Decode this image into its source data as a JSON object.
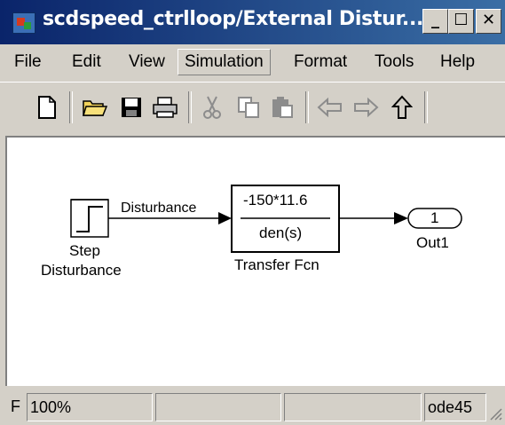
{
  "window": {
    "title": "scdspeed_ctrlloop/External Distur...",
    "minimize_glyph": "_",
    "maximize_glyph": "☐",
    "close_glyph": "✕"
  },
  "menu": {
    "items": [
      "File",
      "Edit",
      "View",
      "Simulation",
      "Format",
      "Tools",
      "Help"
    ],
    "active": "Simulation"
  },
  "toolbar": {
    "icons": [
      "new-file-icon",
      "open-folder-icon",
      "save-icon",
      "print-icon",
      "cut-icon",
      "copy-icon",
      "paste-icon",
      "back-arrow-icon",
      "forward-arrow-icon",
      "up-arrow-icon"
    ]
  },
  "diagram": {
    "step_block_label_line1": "Step",
    "step_block_label_line2": "Disturbance",
    "signal_label": "Disturbance",
    "transfer_numerator": "-150*11.6",
    "transfer_denominator": "den(s)",
    "transfer_label": "Transfer Fcn",
    "outport_number": "1",
    "outport_label": "Out1"
  },
  "status": {
    "left_char": "F",
    "zoom": "100%",
    "solver": "ode45"
  }
}
